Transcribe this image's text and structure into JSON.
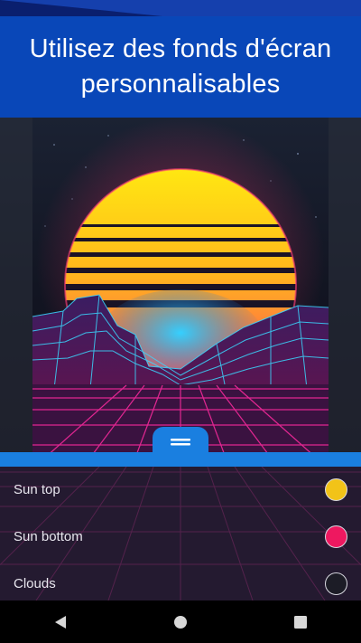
{
  "banner": {
    "title_line1": "Utilisez des fonds d'écran",
    "title_line2": "personnalisables"
  },
  "colors": {
    "banner": "#0947b8",
    "accent": "#1a7fe0",
    "sun_top": "#f2c318",
    "sun_bottom": "#ee1860",
    "clouds": "#1c1c26"
  },
  "settings": {
    "rows": [
      {
        "label": "Sun top",
        "color": "#f2c318"
      },
      {
        "label": "Sun bottom",
        "color": "#ee1860"
      },
      {
        "label": "Clouds",
        "color": "#1c1c26"
      }
    ]
  },
  "handle": {
    "icon": "drag-handle-icon"
  },
  "navigation": {
    "back_icon": "back-triangle-icon",
    "home_icon": "home-circle-icon",
    "recents_icon": "recents-square-icon"
  }
}
